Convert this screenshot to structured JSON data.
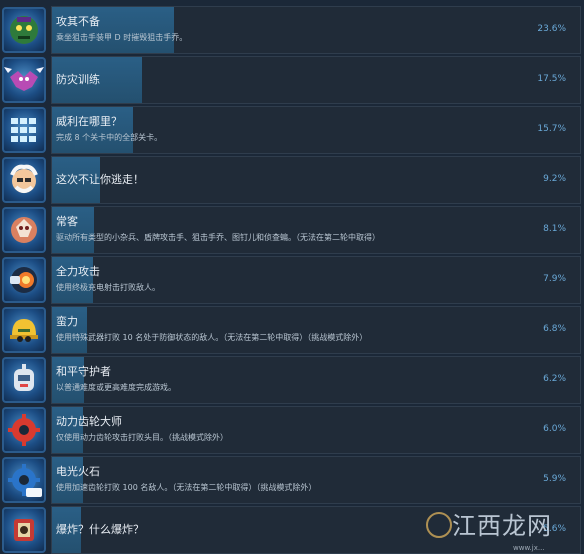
{
  "achievements": [
    {
      "title": "攻其不备",
      "description": "乘坐狙击手装甲 D 时摧毁狙击手乔。",
      "percent_label": "23.6%",
      "fill_fraction": 0.236,
      "icon": "green-goblin-icon"
    },
    {
      "title": "防灾训练",
      "description": "",
      "percent_label": "17.5%",
      "fill_fraction": 0.175,
      "icon": "winged-mask-icon"
    },
    {
      "title": "威利在哪里？",
      "description": "完成 8 个关卡中的全部关卡。",
      "percent_label": "15.7%",
      "fill_fraction": 0.157,
      "icon": "grid-icon"
    },
    {
      "title": "这次不让你逃走！",
      "description": "",
      "percent_label": "9.2%",
      "fill_fraction": 0.092,
      "icon": "scientist-face-icon"
    },
    {
      "title": "常客",
      "description": "驱动所有类型的小杂兵、盾牌攻击手、狙击手乔、图钉儿和侦查蝙。（无法在第二轮中取得）",
      "percent_label": "8.1%",
      "fill_fraction": 0.081,
      "icon": "fighter-icon"
    },
    {
      "title": "全力攻击",
      "description": "使用终极充电射击打败敌人。",
      "percent_label": "7.9%",
      "fill_fraction": 0.079,
      "icon": "buster-icon"
    },
    {
      "title": "蛮力",
      "description": "使用特殊武器打败 10 名处于防御状态的敌人。（无法在第二轮中取得）（挑战模式除外）",
      "percent_label": "6.8%",
      "fill_fraction": 0.068,
      "icon": "hardhat-icon"
    },
    {
      "title": "和平守护者",
      "description": "以普通难度或更高难度完成游戏。",
      "percent_label": "6.2%",
      "fill_fraction": 0.062,
      "icon": "robot-head-icon"
    },
    {
      "title": "动力齿轮大师",
      "description": "仅使用动力齿轮攻击打败头目。（挑战模式除外）",
      "percent_label": "6.0%",
      "fill_fraction": 0.06,
      "icon": "gear-icon"
    },
    {
      "title": "电光火石",
      "description": "使用加速齿轮打败 100 名敌人。（无法在第二轮中取得）（挑战模式除外）",
      "percent_label": "5.9%",
      "fill_fraction": 0.059,
      "icon": "speed-gear-100-icon"
    },
    {
      "title": "爆炸？什么爆炸？",
      "description": "",
      "percent_label": "5.6%",
      "fill_fraction": 0.056,
      "icon": "bomb-icon"
    }
  ],
  "watermark": {
    "text": "江西龙网",
    "sub": "www.jx..."
  },
  "colors": {
    "background": "#1b2838",
    "panel": "#202b38",
    "fill": "#2a5f86",
    "percent": "#6aa9d8"
  }
}
